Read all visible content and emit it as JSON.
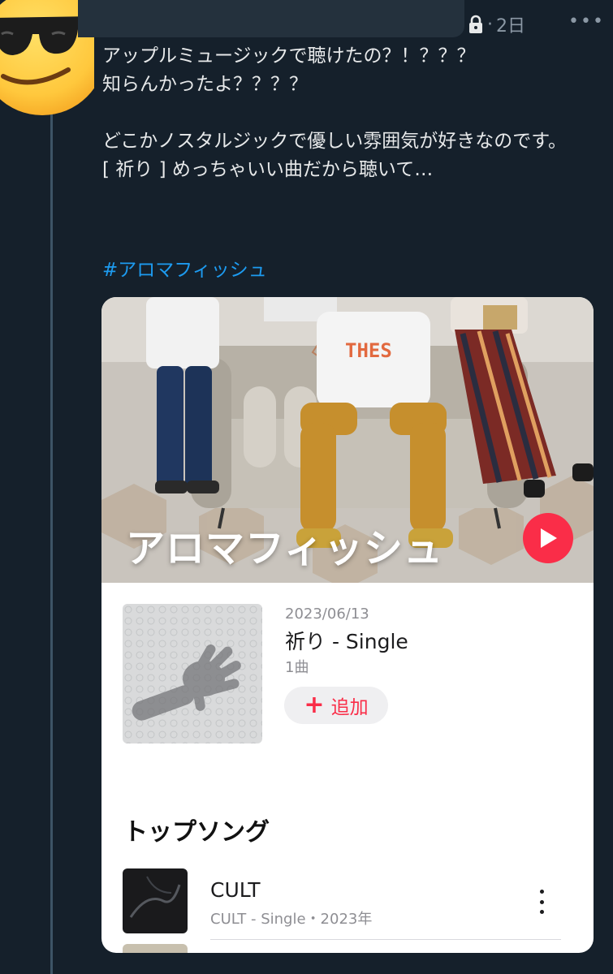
{
  "tweet": {
    "time": "2日",
    "more_label": "•••",
    "text": "アップルミュージックで聴けたの？！？？？\n知らんかったよ？？？？\n\nどこかノスタルジックで優しい雰囲気が好きなのです。\n[ 祈り ] めっちゃいい曲だから聴いて…",
    "hashtag": "#アロマフィッシュ"
  },
  "card": {
    "artist": "アロマフィッシュ",
    "shirt_text": "THES",
    "release": {
      "date": "2023/06/13",
      "title": "祈り - Single",
      "count": "1曲",
      "add_label": "追加"
    },
    "top_songs": {
      "title": "トップソング",
      "items": [
        {
          "title": "CULT",
          "subtitle": "CULT - Single・2023年"
        }
      ]
    }
  },
  "colors": {
    "background": "#15202b",
    "hashtag": "#1d9bf0",
    "apple_music_red": "#fa2d48"
  },
  "icons": [
    "sunglasses-emoji-avatar",
    "lock-icon",
    "more-icon",
    "play-icon",
    "plus-icon",
    "vertical-more-icon"
  ]
}
